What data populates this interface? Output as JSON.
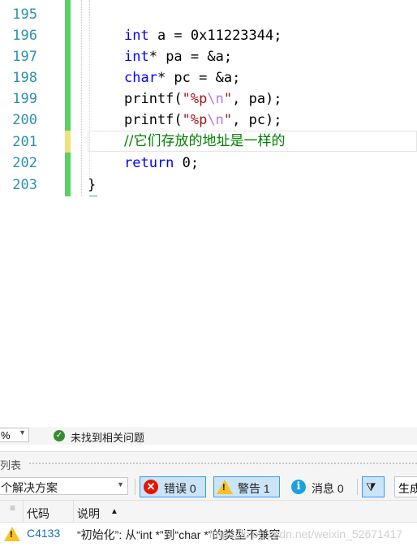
{
  "editor": {
    "line_numbers": [
      "195",
      "196",
      "197",
      "198",
      "199",
      "200",
      "201",
      "202",
      "203"
    ],
    "lines": {
      "l196": {
        "kw": "int",
        "rest": " a = 0x11223344;"
      },
      "l197": {
        "kw": "int",
        "rest": "* pa = &a;"
      },
      "l198": {
        "kw": "char",
        "rest": "* pc = &a;"
      },
      "l199": {
        "fn": "printf(",
        "q1": "\"%p",
        "esc": "\\n",
        "q2": "\"",
        "rest": ", pa);"
      },
      "l200": {
        "fn": "printf(",
        "q1": "\"%p",
        "esc": "\\n",
        "q2": "\"",
        "rest": ", pc);"
      },
      "l201": {
        "comment": "//它们存放的地址是一样的"
      },
      "l202": {
        "kw": "return",
        "rest": " 0;"
      },
      "l203": {
        "brace": "}"
      }
    }
  },
  "status": {
    "zoom": "%",
    "message": "未找到相关问题"
  },
  "error_list": {
    "title": "列表",
    "scope": "个解决方案",
    "errors_label": "错误 0",
    "warnings_label": "警告 1",
    "messages_label": "消息 0",
    "build_label": "生成",
    "columns": {
      "code": "代码",
      "desc": "说明"
    },
    "sort_arrow": "▲",
    "rows": [
      {
        "code": "C4133",
        "description": "“初始化”: 从“int *”到“char *”的类型不兼容"
      }
    ]
  },
  "watermark": "https://blog.csdn.net/weixin_52671417",
  "colors": {
    "accent": "#3399ff",
    "warning": "#f8c325",
    "error": "#e51400",
    "info": "#1ba1e2",
    "ok": "#388a34",
    "change_bar": "#57d163",
    "change_bar_unsaved": "#f0e27a"
  }
}
